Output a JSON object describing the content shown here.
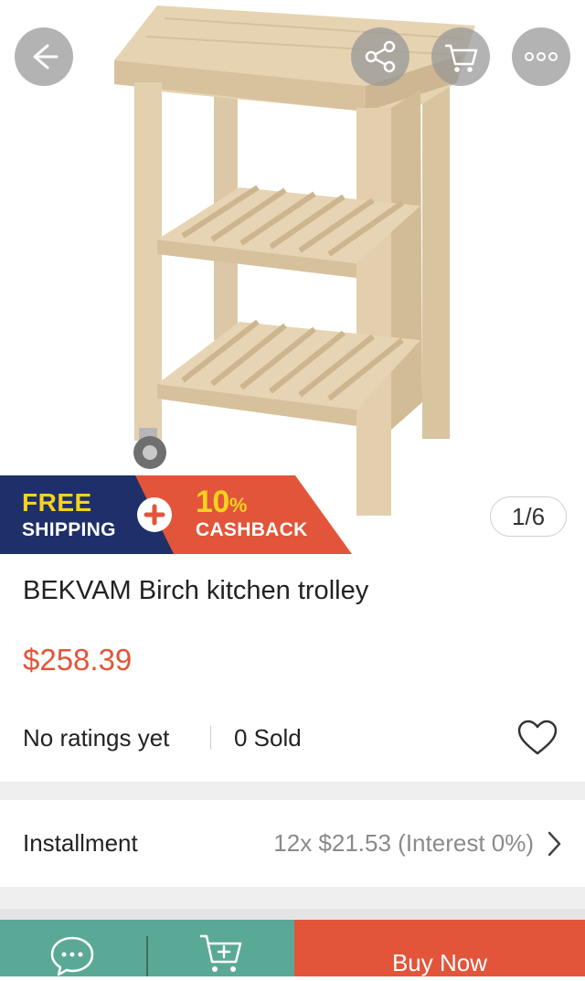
{
  "header": {
    "back_icon": "arrow-left-icon",
    "share_icon": "share-icon",
    "cart_icon": "cart-icon",
    "more_icon": "more-dots-icon"
  },
  "promo": {
    "free_line1": "FREE",
    "free_line2": "SHIPPING",
    "cash_pct_number": "10",
    "cash_pct_sign": "%",
    "cashback": "CASHBACK",
    "colors": {
      "navy": "#1f2f6a",
      "orange": "#e2553a",
      "yellow": "#f7d21e"
    }
  },
  "gallery": {
    "counter": "1/6"
  },
  "product": {
    "title": "BEKVAM Birch kitchen trolley",
    "price": "$258.39",
    "ratings": "No ratings yet",
    "sold": "0 Sold",
    "favorite_icon": "heart-outline-icon"
  },
  "installment": {
    "label": "Installment",
    "value": "12x $21.53 (Interest 0%)",
    "chevron_icon": "chevron-right-icon"
  },
  "bottom_bar": {
    "chat_icon": "chat-icon",
    "add_cart_icon": "add-to-cart-icon",
    "buy_now": "Buy Now",
    "colors": {
      "chat_bg": "#5aa996",
      "buy_bg": "#e2553a"
    }
  }
}
